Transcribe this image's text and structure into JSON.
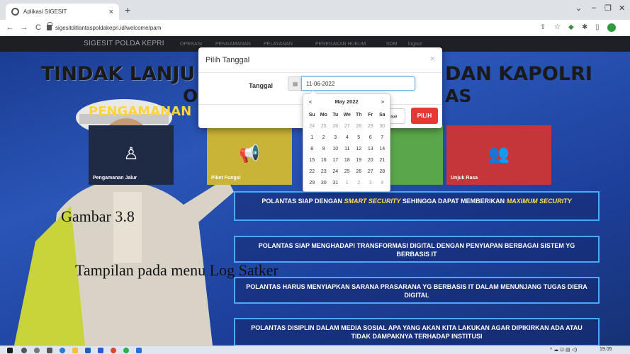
{
  "browser": {
    "tab_title": "Aplikasi SIGESIT",
    "tab_close": "×",
    "new_tab": "+",
    "url": "sigesitditlantaspoldakepri.id/welcome/pam",
    "back": "←",
    "forward": "→",
    "reload": "C"
  },
  "navbar": {
    "brand": "SIGESIT POLDA KEPRI",
    "items": [
      "OPERASI",
      "PENGAMANAN",
      "PELAYANAN",
      "PENEGAKAN HUKUM",
      "SDM",
      "logout"
    ]
  },
  "banner": {
    "line1_left": "TINDAK LANJU",
    "line1_right": "DAN KAPOLRI",
    "line2_left": "O",
    "line2_right": "AS",
    "sub_left": "PENGAMANAN"
  },
  "tiles": [
    {
      "label": "Pengamanan Jalur",
      "color": "#1f2a44",
      "icon": "person-icon"
    },
    {
      "label": "Piket Fungsi",
      "color": "#c9b437",
      "icon": "megaphone-icon"
    },
    {
      "label": "",
      "color": "#5aa64a",
      "icon": ""
    },
    {
      "label": "Unjuk Rasa",
      "color": "#c4363a",
      "icon": "users-icon"
    }
  ],
  "slogans": [
    {
      "parts": [
        "POLANTAS  SIAP DENGAN ",
        "SMART SECURITY",
        " SEHINGGA DAPAT MEMBERIKAN ",
        "MAXIMUM SECURITY"
      ]
    },
    {
      "text": "POLANTAS SIAP MENGHADAPI TRANSFORMASI DIGITAL DENGAN PENYIAPAN BERBAGAI SISTEM YG BERBASIS IT"
    },
    {
      "text": "POLANTAS HARUS MENYIAPKAN SARANA PRASARANA YG BERBASIS IT DALAM MENUNJANG TUGAS DIERA DIGITAL"
    },
    {
      "text": "POLANTAS DISIPLIN DALAM MEDIA SOSIAL APA YANG AKAN KITA LAKUKAN AGAR DIPIKIRKAN ADA ATAU TIDAK DAMPAKNYA TERHADAP INSTITUSI"
    }
  ],
  "caption": {
    "line1": "Gambar 3.8",
    "line2": "Tampilan pada menu Log Satker"
  },
  "modal": {
    "title": "Pilih Tanggal",
    "close_x": "×",
    "field_label": "Tanggal",
    "date_value": "11-06-2022",
    "close_button": "lose",
    "submit_button": "PILIH"
  },
  "datepicker": {
    "prev": "«",
    "next": "»",
    "month_title": "May 2022",
    "weekdays": [
      "Su",
      "Mo",
      "Tu",
      "We",
      "Th",
      "Fr",
      "Sa"
    ],
    "weeks": [
      [
        "24",
        "25",
        "26",
        "27",
        "28",
        "29",
        "30"
      ],
      [
        "1",
        "2",
        "3",
        "4",
        "5",
        "6",
        "7"
      ],
      [
        "8",
        "9",
        "10",
        "11",
        "12",
        "13",
        "14"
      ],
      [
        "15",
        "16",
        "17",
        "18",
        "19",
        "20",
        "21"
      ],
      [
        "22",
        "23",
        "24",
        "25",
        "26",
        "27",
        "28"
      ],
      [
        "29",
        "30",
        "31",
        "1",
        "2",
        "3",
        "4"
      ]
    ]
  },
  "taskbar": {
    "clock": "19.05"
  }
}
